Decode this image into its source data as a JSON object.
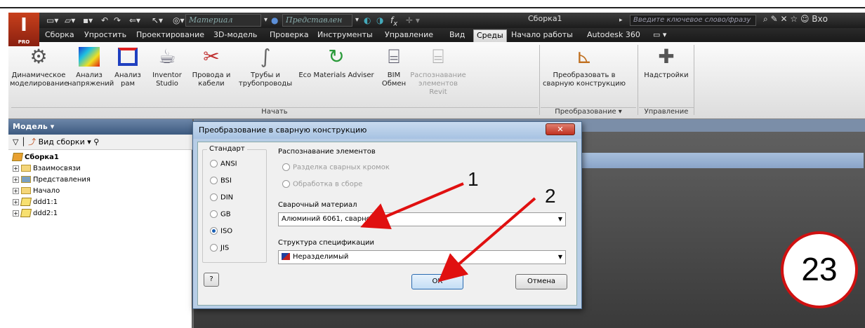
{
  "app": {
    "logo_letter": "I",
    "logo_sub": "PRO",
    "quick_access": {
      "material_field": "Материал",
      "appearance_field": "Представлен"
    },
    "document_title": "Сборка1",
    "search_placeholder": "Введите ключевое слово/фразу",
    "signin_label": "Вхо"
  },
  "tabs": [
    {
      "label": "Сборка"
    },
    {
      "label": "Упростить"
    },
    {
      "label": "Проектирование"
    },
    {
      "label": "3D-модель"
    },
    {
      "label": "Проверка"
    },
    {
      "label": "Инструменты"
    },
    {
      "label": "Управление"
    },
    {
      "label": "Вид"
    },
    {
      "label": "Среды"
    },
    {
      "label": "Начало работы"
    },
    {
      "label": "Autodesk 360"
    }
  ],
  "ribbon": {
    "buttons": [
      {
        "line1": "Динамическое",
        "line2": "моделирование",
        "icon": "dynamic-sim-icon"
      },
      {
        "line1": "Анализ",
        "line2": "напряжений",
        "icon": "stress-analysis-icon"
      },
      {
        "line1": "Анализ",
        "line2": "рам",
        "icon": "frame-analysis-icon"
      },
      {
        "line1": "Inventor",
        "line2": "Studio",
        "icon": "teapot-icon"
      },
      {
        "line1": "Провода и",
        "line2": "кабели",
        "icon": "cable-icon"
      },
      {
        "line1": "Трубы и",
        "line2": "трубопроводы",
        "icon": "pipe-icon"
      },
      {
        "line1": "Eco Materials Adviser",
        "line2": "",
        "icon": "eco-icon"
      },
      {
        "line1": "BIM",
        "line2": "Обмен",
        "icon": "bim-icon"
      },
      {
        "line1": "Распознавание",
        "line2": "элементов Revit",
        "icon": "revit-icon"
      },
      {
        "line1": "Преобразовать в",
        "line2": "сварную конструкцию",
        "icon": "weldment-convert-icon"
      },
      {
        "line1": "Надстройки",
        "line2": "",
        "icon": "addins-icon"
      }
    ],
    "panels": {
      "start": "Начать",
      "convert": "Преобразование ▾",
      "manage": "Управление"
    }
  },
  "browser": {
    "header": "Модель ▾",
    "view_label": "Вид сборки",
    "tree": [
      {
        "label": "Сборка1",
        "kind": "root"
      },
      {
        "label": "Взаимосвязи",
        "kind": "folder"
      },
      {
        "label": "Представления",
        "kind": "folder"
      },
      {
        "label": "Начало",
        "kind": "folder"
      },
      {
        "label": "ddd1:1",
        "kind": "part"
      },
      {
        "label": "ddd2:1",
        "kind": "part"
      }
    ]
  },
  "dialog": {
    "title": "Преобразование в сварную конструкцию",
    "standard_group": "Стандарт",
    "standards": [
      {
        "label": "ANSI",
        "selected": false
      },
      {
        "label": "BSI",
        "selected": false
      },
      {
        "label": "DIN",
        "selected": false
      },
      {
        "label": "GB",
        "selected": false
      },
      {
        "label": "ISO",
        "selected": true
      },
      {
        "label": "JIS",
        "selected": false
      }
    ],
    "recognition_group": "Распознавание элементов",
    "recognition_options": [
      {
        "label": "Разделка сварных кромок"
      },
      {
        "label": "Обработка в сборе"
      }
    ],
    "weld_material_label": "Сварочный материал",
    "weld_material_value": "Алюминий 6061, сварной",
    "bom_label": "Структура спецификации",
    "bom_value": "Неразделимый",
    "ok_label": "ОК",
    "cancel_label": "Отмена",
    "help_label": "?"
  },
  "annotations": {
    "callout_1": "1",
    "callout_2": "2",
    "step_badge": "23",
    "arrow_color": "#e01010"
  }
}
